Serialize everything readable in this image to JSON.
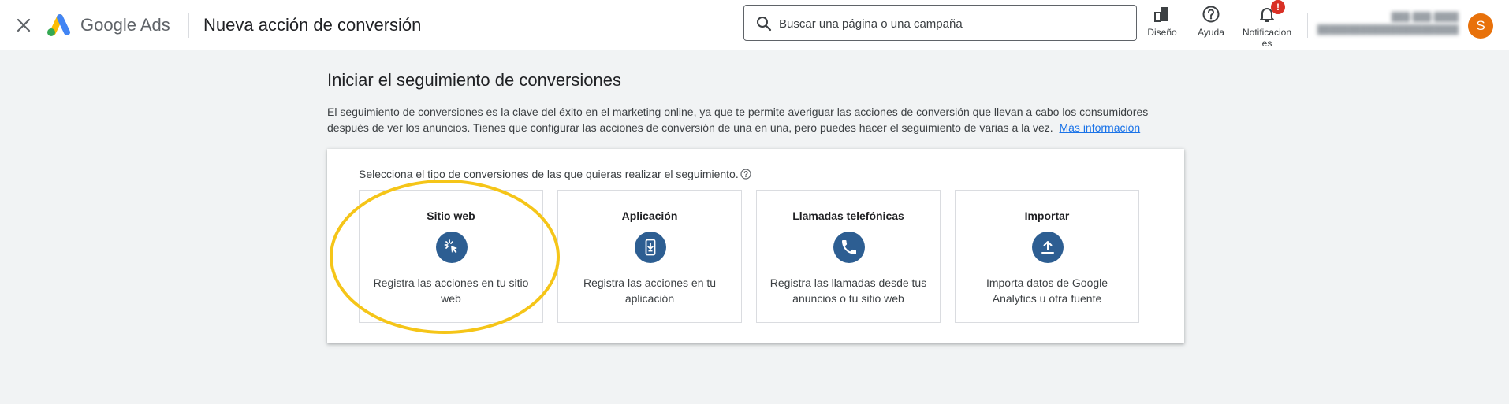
{
  "header": {
    "brand": "Google Ads",
    "page_title": "Nueva acción de conversión",
    "search": {
      "placeholder": "Buscar una página o una campaña"
    },
    "buttons": {
      "design": "Diseño",
      "help": "Ayuda",
      "notifications": "Notificacion\nes",
      "notifications_badge": "!"
    },
    "account": {
      "avatar_letter": "S"
    }
  },
  "main": {
    "heading": "Iniciar el seguimiento de conversiones",
    "description": "El seguimiento de conversiones es la clave del éxito en el marketing online, ya que te permite averiguar las acciones de conversión que llevan a cabo los consumidores después de ver los anuncios. Tienes que configurar las acciones de conversión de una en una, pero puedes hacer el seguimiento de varias a la vez.",
    "learn_more": "Más información",
    "prompt": "Selecciona el tipo de conversiones de las que quieras realizar el seguimiento.",
    "cards": [
      {
        "title": "Sitio web",
        "icon": "cursor-click-icon",
        "description": "Registra las acciones en tu sitio web"
      },
      {
        "title": "Aplicación",
        "icon": "phone-download-icon",
        "description": "Registra las acciones en tu aplicación"
      },
      {
        "title": "Llamadas telefónicas",
        "icon": "phone-call-icon",
        "description": "Registra las llamadas desde tus anuncios o tu sitio web"
      },
      {
        "title": "Importar",
        "icon": "upload-icon",
        "description": "Importa datos de Google Analytics u otra fuente"
      }
    ]
  },
  "colors": {
    "accent": "#1a73e8",
    "icon_circle": "#2d5e92",
    "highlight": "#f5c518",
    "avatar": "#e8710a",
    "badge": "#d93025"
  }
}
